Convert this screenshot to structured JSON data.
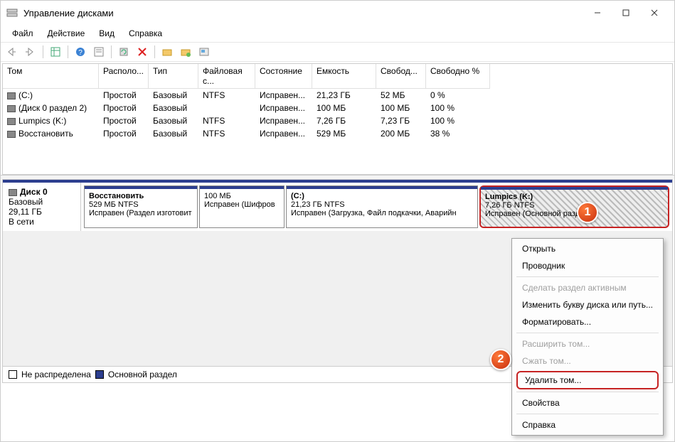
{
  "window": {
    "title": "Управление дисками"
  },
  "menu": {
    "file": "Файл",
    "action": "Действие",
    "view": "Вид",
    "help": "Справка"
  },
  "table": {
    "headers": {
      "volume": "Том",
      "layout": "Располо...",
      "type": "Тип",
      "fs": "Файловая с...",
      "status": "Состояние",
      "capacity": "Емкость",
      "free": "Свобод...",
      "freep": "Свободно %"
    },
    "rows": [
      {
        "vol": "(C:)",
        "layout": "Простой",
        "type": "Базовый",
        "fs": "NTFS",
        "status": "Исправен...",
        "cap": "21,23 ГБ",
        "free": "52 МБ",
        "freep": "0 %"
      },
      {
        "vol": "(Диск 0 раздел 2)",
        "layout": "Простой",
        "type": "Базовый",
        "fs": "",
        "status": "Исправен...",
        "cap": "100 МБ",
        "free": "100 МБ",
        "freep": "100 %"
      },
      {
        "vol": "Lumpics (K:)",
        "layout": "Простой",
        "type": "Базовый",
        "fs": "NTFS",
        "status": "Исправен...",
        "cap": "7,26 ГБ",
        "free": "7,23 ГБ",
        "freep": "100 %"
      },
      {
        "vol": "Восстановить",
        "layout": "Простой",
        "type": "Базовый",
        "fs": "NTFS",
        "status": "Исправен...",
        "cap": "529 МБ",
        "free": "200 МБ",
        "freep": "38 %"
      }
    ]
  },
  "disk": {
    "name": "Диск 0",
    "type": "Базовый",
    "size": "29,11 ГБ",
    "state": "В сети",
    "parts": [
      {
        "name": "Восстановить",
        "line2": "529 МБ NTFS",
        "line3": "Исправен (Раздел изготовит"
      },
      {
        "name": "",
        "line2": "100 МБ",
        "line3": "Исправен (Шифров"
      },
      {
        "name": "(C:)",
        "line2": "21,23 ГБ NTFS",
        "line3": "Исправен (Загрузка, Файл подкачки, Аварийн"
      },
      {
        "name": "Lumpics  (K:)",
        "line2": "7,26 ГБ NTFS",
        "line3": "Исправен (Основной раздел)"
      }
    ]
  },
  "legend": {
    "unalloc": "Не распределена",
    "primary": "Основной раздел"
  },
  "ctx": {
    "open": "Открыть",
    "explorer": "Проводник",
    "mark_active": "Сделать раздел активным",
    "change_letter": "Изменить букву диска или путь...",
    "format": "Форматировать...",
    "extend": "Расширить том...",
    "shrink": "Сжать том...",
    "delete": "Удалить том...",
    "props": "Свойства",
    "help": "Справка"
  },
  "badges": {
    "one": "1",
    "two": "2"
  }
}
